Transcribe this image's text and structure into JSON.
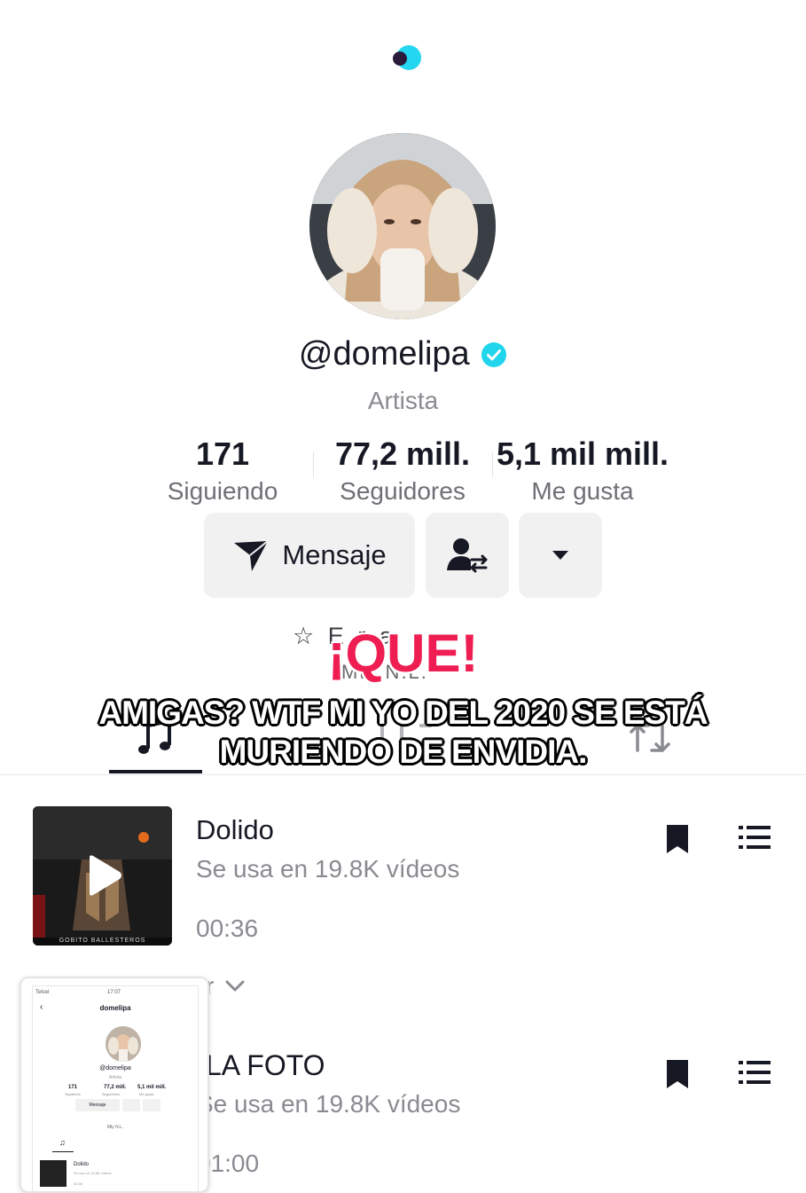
{
  "profile": {
    "username": "@domelipa",
    "category": "Artista",
    "stats": [
      {
        "value": "171",
        "label": "Siguiendo"
      },
      {
        "value": "77,2 mill.",
        "label": "Seguidores"
      },
      {
        "value": "5,1 mil mill.",
        "label": "Me gusta"
      }
    ]
  },
  "actions": {
    "message_label": "Mensaje"
  },
  "bio": {
    "line1_partial": "☆ E      r       a",
    "line2_partial": "Mty N.L."
  },
  "overlay": {
    "headline": "¡QUE!",
    "caption": "AMIGAS? WTF MI YO DEL 2020 SE ESTÁ MURIENDO DE ENVIDIA."
  },
  "songs": [
    {
      "title": "Dolido",
      "uses": "Se usa en 19.8K vídeos",
      "duration": "00:36",
      "cover_text": "GOBITO BALLESTEROS"
    },
    {
      "title_partial": "LA FOTO",
      "uses_partial": "Se usa en 19.8K vídeos",
      "duration_partial": "01:00"
    }
  ],
  "partial_row": {
    "text": "r"
  },
  "pip_preview": {
    "status_left": "Telcel",
    "status_time": "17:07",
    "title": "domelipa",
    "username": "@domelipa",
    "category": "Artista",
    "stats": [
      {
        "value": "171",
        "label": "Siguiendo"
      },
      {
        "value": "77,2 mill.",
        "label": "Seguidores"
      },
      {
        "value": "5,1 mil mill.",
        "label": "Me gusta"
      }
    ],
    "message_label": "Mensaje",
    "bio_line": "Mty N.L.",
    "song_title": "Dolido",
    "song_uses": "Se usa en 19.8K vídeos",
    "song_duration": "00:36"
  },
  "icons": {
    "verified": "verified-badge-icon",
    "message": "paper-plane-icon",
    "follow_swap": "user-swap-icon",
    "more": "caret-down-icon",
    "music_tab": "music-note-icon",
    "repost_tab": "repost-icon",
    "bookmark": "bookmark-icon",
    "list": "list-icon"
  },
  "colors": {
    "accent_red": "#ee1d52",
    "verified_blue": "#20d5ec",
    "button_bg": "#f1f1f2"
  }
}
